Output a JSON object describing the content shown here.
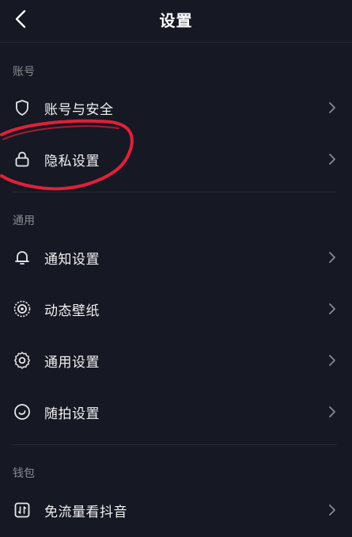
{
  "header": {
    "title": "设置"
  },
  "sections": [
    {
      "title": "账号",
      "items": [
        {
          "label": "账号与安全",
          "icon": "shield-icon"
        },
        {
          "label": "隐私设置",
          "icon": "lock-icon"
        }
      ]
    },
    {
      "title": "通用",
      "items": [
        {
          "label": "通知设置",
          "icon": "bell-icon"
        },
        {
          "label": "动态壁纸",
          "icon": "wallpaper-icon"
        },
        {
          "label": "通用设置",
          "icon": "gear-icon"
        },
        {
          "label": "随拍设置",
          "icon": "snapshot-icon"
        }
      ]
    },
    {
      "title": "钱包",
      "items": [
        {
          "label": "免流量看抖音",
          "icon": "data-free-icon"
        }
      ]
    }
  ],
  "colors": {
    "background": "#161823",
    "text": "#f1f1f2",
    "muted": "#8a8b91",
    "annotation": "#e0203a"
  }
}
